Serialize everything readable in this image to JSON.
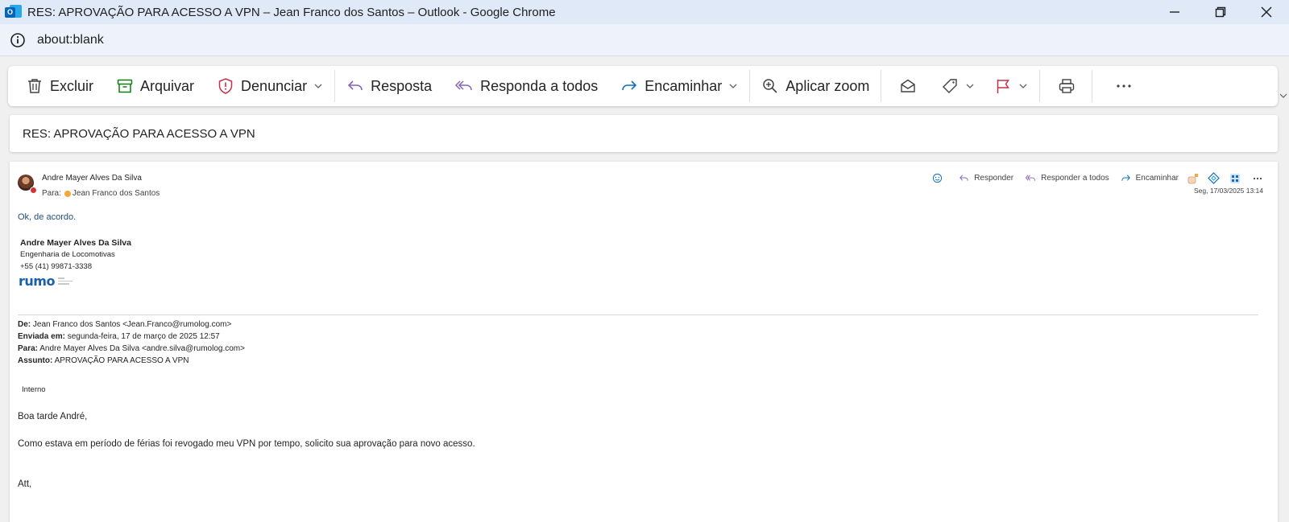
{
  "window": {
    "title": "RES: APROVAÇÃO PARA ACESSO A VPN – Jean Franco dos Santos – Outlook - Google Chrome"
  },
  "address": {
    "url": "about:blank"
  },
  "toolbar": {
    "delete_label": "Excluir",
    "archive_label": "Arquivar",
    "report_label": "Denunciar",
    "reply_label": "Resposta",
    "reply_all_label": "Responda a todos",
    "forward_label": "Encaminhar",
    "zoom_label": "Aplicar zoom"
  },
  "subject": "RES: APROVAÇÃO PARA ACESSO A VPN",
  "message": {
    "sender": "Andre Mayer Alves Da Silva",
    "to_prefix": "Para:",
    "to_name": "Jean Franco dos Santos",
    "actions": {
      "reply": "Responder",
      "reply_all": "Responder a todos",
      "forward": "Encaminhar"
    },
    "date": "Seg, 17/03/2025 13:14",
    "reply_text": "Ok, de acordo.",
    "signature": {
      "name": "Andre Mayer Alves Da Silva",
      "department": "Engenharia de Locomotivas",
      "phone": "+55 (41) 99871-3338",
      "logo_text": "rumo"
    },
    "quoted_header": {
      "from_label": "De:",
      "from_value": " Jean Franco dos Santos <Jean.Franco@rumolog.com>",
      "sent_label": "Enviada em:",
      "sent_value": " segunda-feira, 17 de março de 2025 12:57",
      "to_label": "Para:",
      "to_value": " Andre Mayer Alves Da Silva <andre.silva@rumolog.com>",
      "subject_label": "Assunto:",
      "subject_value": " APROVAÇÃO PARA ACESSO A VPN"
    },
    "classification": "Interno",
    "greeting": "Boa tarde André,",
    "body": "Como estava em período de férias foi revogado meu VPN por tempo, solicito sua aprovação para novo acesso.",
    "closing": "Att,"
  },
  "colors": {
    "titlebar_bg": "#dfe9f7",
    "accent_blue": "#0f6cbd",
    "report_red": "#c4314b",
    "archive_green": "#107c10",
    "reply_purple": "#8764b8"
  }
}
